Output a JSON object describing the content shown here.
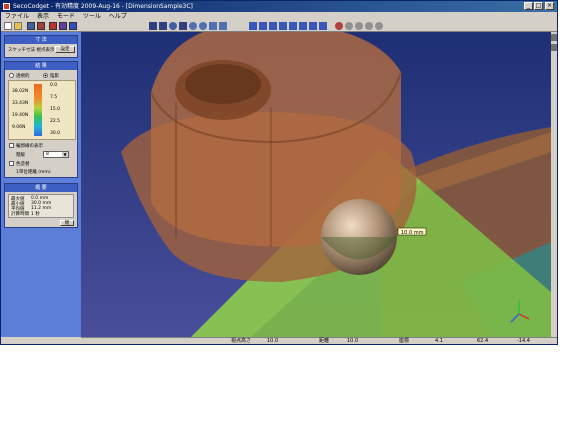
{
  "window": {
    "title": "SecoCodget - 有効精度 2009-Aug-16 - [DimensionSample3C]"
  },
  "menu": [
    "ファイル",
    "表示",
    "モード",
    "ツール",
    "ヘルプ"
  ],
  "panel": {
    "section1": {
      "title": "寸 法",
      "label": "スケッチ寸法 視点表示",
      "button": "設定"
    },
    "section2": {
      "title": "結 果",
      "radio1": "透視的",
      "radio2": "陰影",
      "legend_values": [
        "0.0",
        "7.5",
        "15.0",
        "22.5",
        "30.0"
      ],
      "legend_left": [
        "38.02N",
        "33.43N",
        "19.40N",
        "9.06N"
      ],
      "check1": "輪郭線の表示",
      "step_label": "階級",
      "step_value": "8",
      "check2": "色塗替",
      "note": "1単位距離 (mm)"
    },
    "section3": {
      "title": "概 要",
      "rows": [
        {
          "label": "最大値",
          "value": "0.0 mm"
        },
        {
          "label": "最小値",
          "value": "30.0 mm"
        },
        {
          "label": "平均値",
          "value": "11.2 mm"
        },
        {
          "label": "計算時間",
          "value": "1 秒"
        }
      ],
      "button": "閉"
    }
  },
  "viewport": {
    "tooltip": "10.0 mm"
  },
  "status": {
    "label1": "視点高さ",
    "value1": "10.0",
    "label2": "距離",
    "value2": "10.0",
    "label3": "座標",
    "x": "4.1",
    "y": "62.4",
    "z": "-14.4"
  },
  "colors": {
    "bg_top": "#1d2f75",
    "bg_bottom": "#4a4e9a",
    "part_brown": "#a2613b",
    "part_green": "#7ebd47",
    "panel_blue": "#5c7ed8"
  }
}
